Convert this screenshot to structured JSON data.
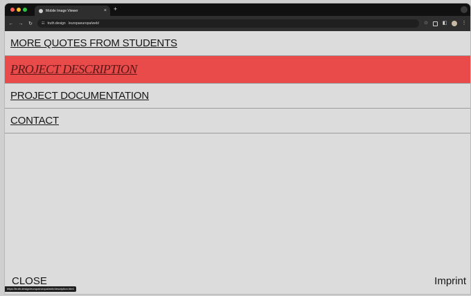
{
  "browser": {
    "tab_title": "Mobile Image Viewer",
    "address_host": "truth.design",
    "address_path": "/europaeuropa/web/",
    "status_url": "https://truth.design/europaeuropa/web/description.html"
  },
  "menu": {
    "items": [
      {
        "label": "MORE QUOTES FROM STUDENTS"
      },
      {
        "label": "PROJECT DESCRIPTION"
      },
      {
        "label": "PROJECT DOCUMENTATION"
      },
      {
        "label": "CONTACT"
      }
    ]
  },
  "footer": {
    "close_label": "CLOSE",
    "imprint_label": "Imprint"
  },
  "colors": {
    "active_background": "#e94a4a",
    "page_background": "#dcdcdc",
    "text": "#161616"
  },
  "icons": {
    "tab_close": "close-icon",
    "new_tab": "plus-icon",
    "back": "back-arrow-icon",
    "forward": "forward-arrow-icon",
    "reload": "reload-icon",
    "bookmark": "star-icon",
    "extensions": "extensions-icon",
    "split_view": "split-view-icon",
    "menu": "kebab-menu-icon"
  }
}
